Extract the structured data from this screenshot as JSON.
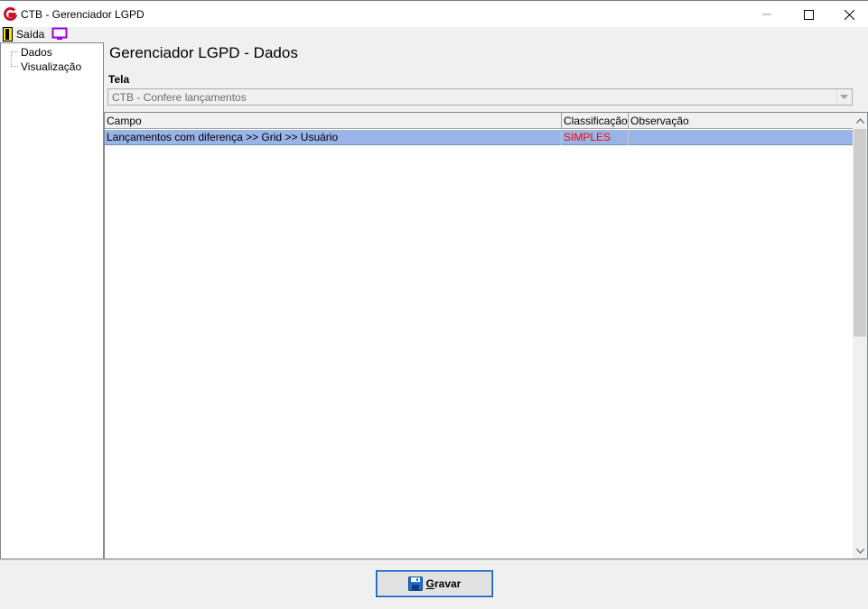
{
  "window": {
    "title": "CTB - Gerenciador LGPD",
    "app_icon": "g-logo-icon",
    "minimize_glyph": "—",
    "maximize_glyph": "☐",
    "close_glyph": "✕"
  },
  "toolbar": {
    "exit_label": "Saída",
    "exit_icon": "exit-door-icon",
    "monitor_icon": "monitor-icon"
  },
  "sidebar": {
    "items": [
      {
        "label": "Dados"
      },
      {
        "label": "Visualização"
      }
    ]
  },
  "main": {
    "title": "Gerenciador LGPD - Dados",
    "tela_label": "Tela",
    "tela_value": "CTB - Confere lançamentos"
  },
  "grid": {
    "columns": [
      "Campo",
      "Classificação",
      "Observação"
    ],
    "rows": [
      {
        "campo": "Lançamentos com diferença >> Grid >> Usuário",
        "classificacao": "SIMPLES",
        "observacao": ""
      }
    ],
    "selected_row_color": "#99b4e6",
    "classificacao_color": "#ff0000"
  },
  "footer": {
    "save_label_first": "G",
    "save_label_rest": "ravar",
    "save_icon": "floppy-disk-icon"
  }
}
